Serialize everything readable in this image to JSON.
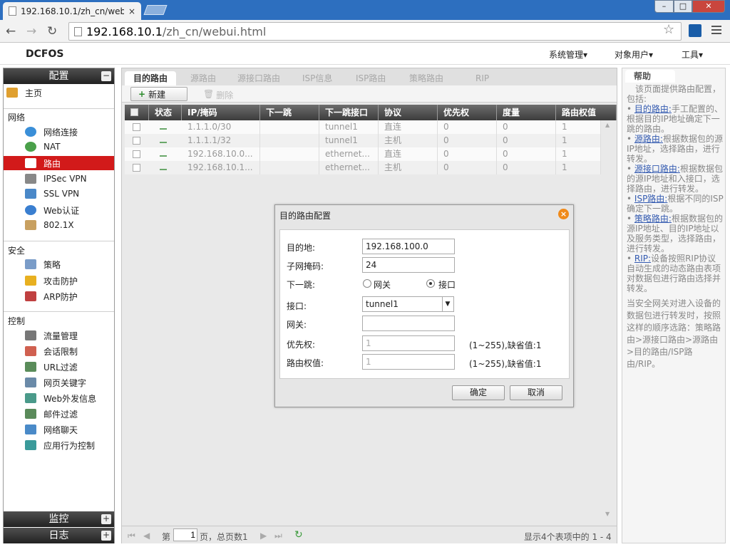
{
  "browser": {
    "tab_title": "192.168.10.1/zh_cn/web",
    "tab_close": "×",
    "url_host": "192.168.10.1",
    "url_path": "/zh_cn/webui.html",
    "win_min": "–",
    "win_max": "□",
    "win_close": "✕"
  },
  "header": {
    "logo": "DCFOS",
    "menus": [
      "系统管理▾",
      "对象用户▾",
      "工具▾"
    ]
  },
  "sidebar": {
    "title": "配置",
    "home": "主页",
    "groups": [
      {
        "label": "网络",
        "items": [
          "网络连接",
          "NAT",
          "路由",
          "IPSec VPN",
          "SSL VPN",
          "Web认证",
          "802.1X"
        ]
      },
      {
        "label": "安全",
        "items": [
          "策略",
          "攻击防护",
          "ARP防护"
        ]
      },
      {
        "label": "控制",
        "items": [
          "流量管理",
          "会话限制",
          "URL过滤",
          "网页关键字",
          "Web外发信息",
          "邮件过滤",
          "网络聊天",
          "应用行为控制"
        ]
      }
    ],
    "active_item": "路由",
    "monitor": "监控",
    "log": "日志",
    "toggle_collapse": "−",
    "toggle_expand": "+"
  },
  "main": {
    "tabs": [
      "目的路由",
      "源路由",
      "源接口路由",
      "ISP信息",
      "ISP路由",
      "策略路由",
      "RIP"
    ],
    "new_label": "新建",
    "delete_label": "删除",
    "columns": [
      "状态",
      "IP/掩码",
      "下一跳",
      "下一跳接口",
      "协议",
      "优先权",
      "度量",
      "路由权值"
    ],
    "rows": [
      {
        "ip": "1.1.1.0/30",
        "next_hop": "",
        "iface": "tunnel1",
        "proto": "直连",
        "priority": "0",
        "metric": "0",
        "weight": "1"
      },
      {
        "ip": "1.1.1.1/32",
        "next_hop": "",
        "iface": "tunnel1",
        "proto": "主机",
        "priority": "0",
        "metric": "0",
        "weight": "1"
      },
      {
        "ip": "192.168.10.0...",
        "next_hop": "",
        "iface": "ethernet...",
        "proto": "直连",
        "priority": "0",
        "metric": "0",
        "weight": "1"
      },
      {
        "ip": "192.168.10.1...",
        "next_hop": "",
        "iface": "ethernet...",
        "proto": "主机",
        "priority": "0",
        "metric": "0",
        "weight": "1"
      }
    ],
    "pager": {
      "first": "⏮",
      "prev": "◀",
      "next": "▶",
      "last": "⏭",
      "page_prefix": "第",
      "page_value": "1",
      "page_suffix": "页，总页数1",
      "summary": "显示4个表项中的 1 - 4"
    }
  },
  "dialog": {
    "title": "目的路由配置",
    "close": "×",
    "fields": {
      "dest_label": "目的地:",
      "dest_value": "192.168.100.0",
      "mask_label": "子网掩码:",
      "mask_value": "24",
      "nexthop_label": "下一跳:",
      "radio_gateway": "网关",
      "radio_iface": "接口",
      "iface_label": "接口:",
      "iface_value": "tunnel1",
      "gateway_label": "网关:",
      "gateway_value": "",
      "priority_label": "优先权:",
      "priority_value": "1",
      "priority_hint": "(1~255),缺省值:1",
      "weight_label": "路由权值:",
      "weight_value": "1",
      "weight_hint": "(1~255),缺省值:1"
    },
    "ok": "确定",
    "cancel": "取消"
  },
  "help": {
    "tab": "帮助",
    "intro": "该页面提供路由配置，包括:",
    "items": [
      {
        "link": "目的路由:",
        "text": "手工配置的、根据目的IP地址确定下一跳的路由。"
      },
      {
        "link": "源路由:",
        "text": "根据数据包的源IP地址，选择路由，进行转发。"
      },
      {
        "link": "源接口路由:",
        "text": "根据数据包的源IP地址和入接口，选择路由，进行转发。"
      },
      {
        "link": "ISP路由:",
        "text": "根据不同的ISP确定下一跳。"
      },
      {
        "link": "策略路由:",
        "text": "根据数据包的源IP地址、目的IP地址以及服务类型，选择路由，进行转发。"
      },
      {
        "link": "RIP:",
        "text": "设备按照RIP协议自动生成的动态路由表项对数据包进行路由选择并转发。"
      }
    ],
    "footer": "当安全网关对进入设备的数据包进行转发时，按照这样的顺序选路：策略路由>源接口路由>源路由>目的路由/ISP路由/RIP。"
  },
  "colors": {
    "active_nav": "#d21a1a",
    "link": "#335ab0",
    "chrome_blue": "#2d6fbf"
  }
}
